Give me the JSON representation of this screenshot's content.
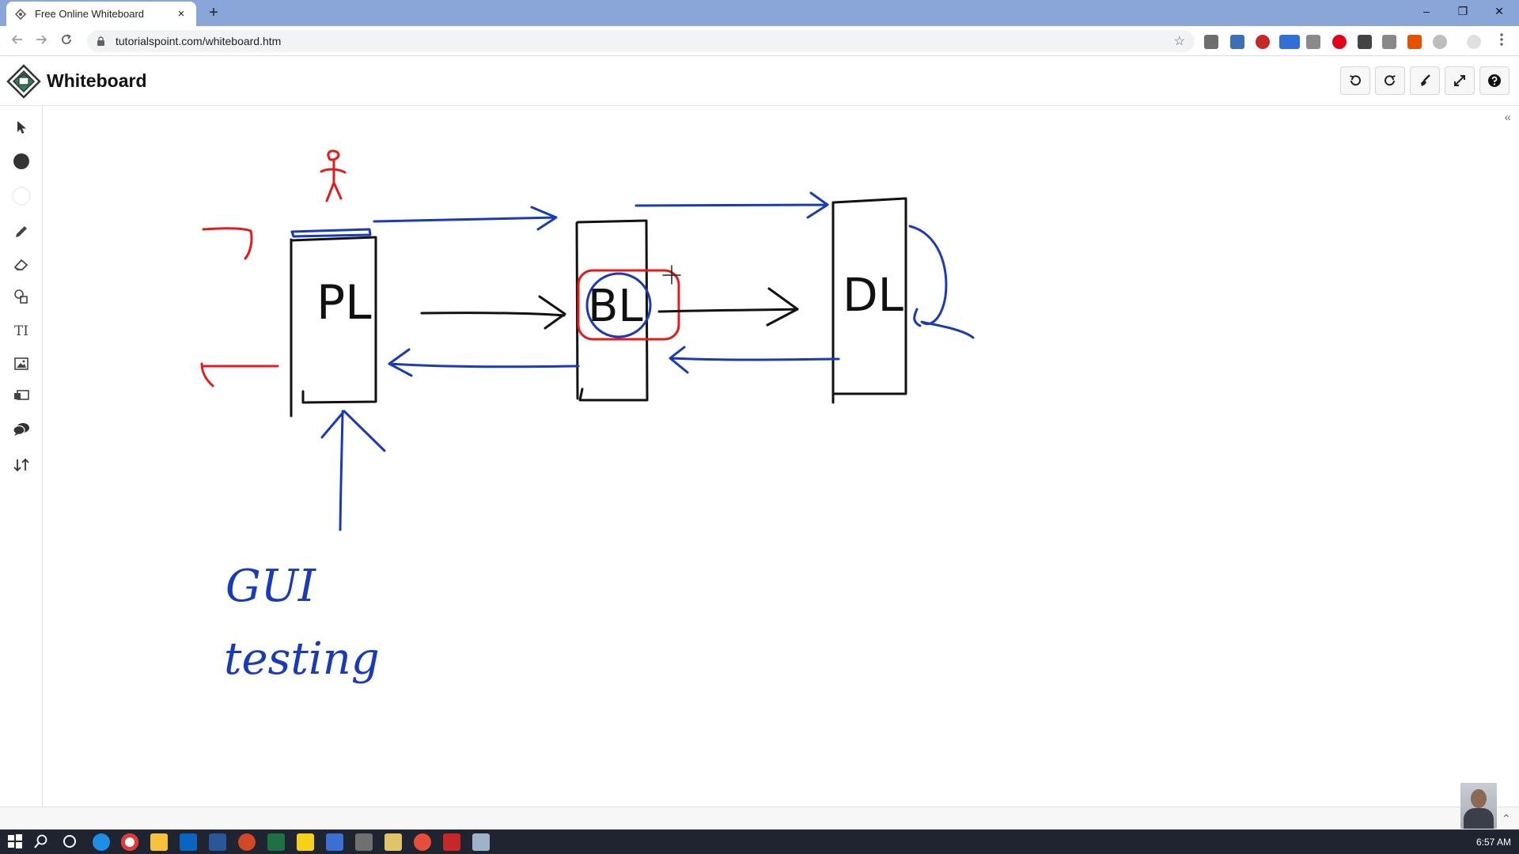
{
  "browser": {
    "tab_title": "Free Online Whiteboard",
    "tab_close": "×",
    "new_tab": "+",
    "url": "tutorialspoint.com/whiteboard.htm",
    "window_controls": {
      "minimize": "–",
      "restore": "❐",
      "close": "✕"
    }
  },
  "app": {
    "title": "Whiteboard",
    "header_buttons": [
      "undo-icon",
      "redo-icon",
      "brush-icon",
      "fullscreen-icon",
      "help-icon"
    ]
  },
  "tools": {
    "items": [
      "pointer-icon",
      "circle-fill-icon",
      "circle-outline-icon",
      "pencil-icon",
      "eraser-icon",
      "shapes-icon",
      "text-icon",
      "image-icon",
      "media-icon",
      "comment-icon",
      "sort-icon"
    ],
    "text_tool_label": "TI"
  },
  "palette": {
    "colors": [
      {
        "name": "red",
        "hex": "#e8161a",
        "selected": true
      },
      {
        "name": "black",
        "hex": "#000000"
      },
      {
        "name": "red",
        "hex": "#ff0000"
      },
      {
        "name": "green",
        "hex": "#0a5a28"
      },
      {
        "name": "yellow",
        "hex": "#fbc21a"
      },
      {
        "name": "white",
        "hex": "#ffffff"
      },
      {
        "name": "blue",
        "hex": "#0038e0"
      }
    ],
    "stroke_width": "3"
  },
  "canvas": {
    "labels": [
      "PL",
      "BL",
      "DL"
    ],
    "annotation_text": [
      "GUI",
      "testing"
    ],
    "stroke_colors": {
      "black": "#111111",
      "blue": "#1a3bb8",
      "red": "#e31b1b"
    }
  },
  "taskbar": {
    "time": "6:57 AM"
  }
}
